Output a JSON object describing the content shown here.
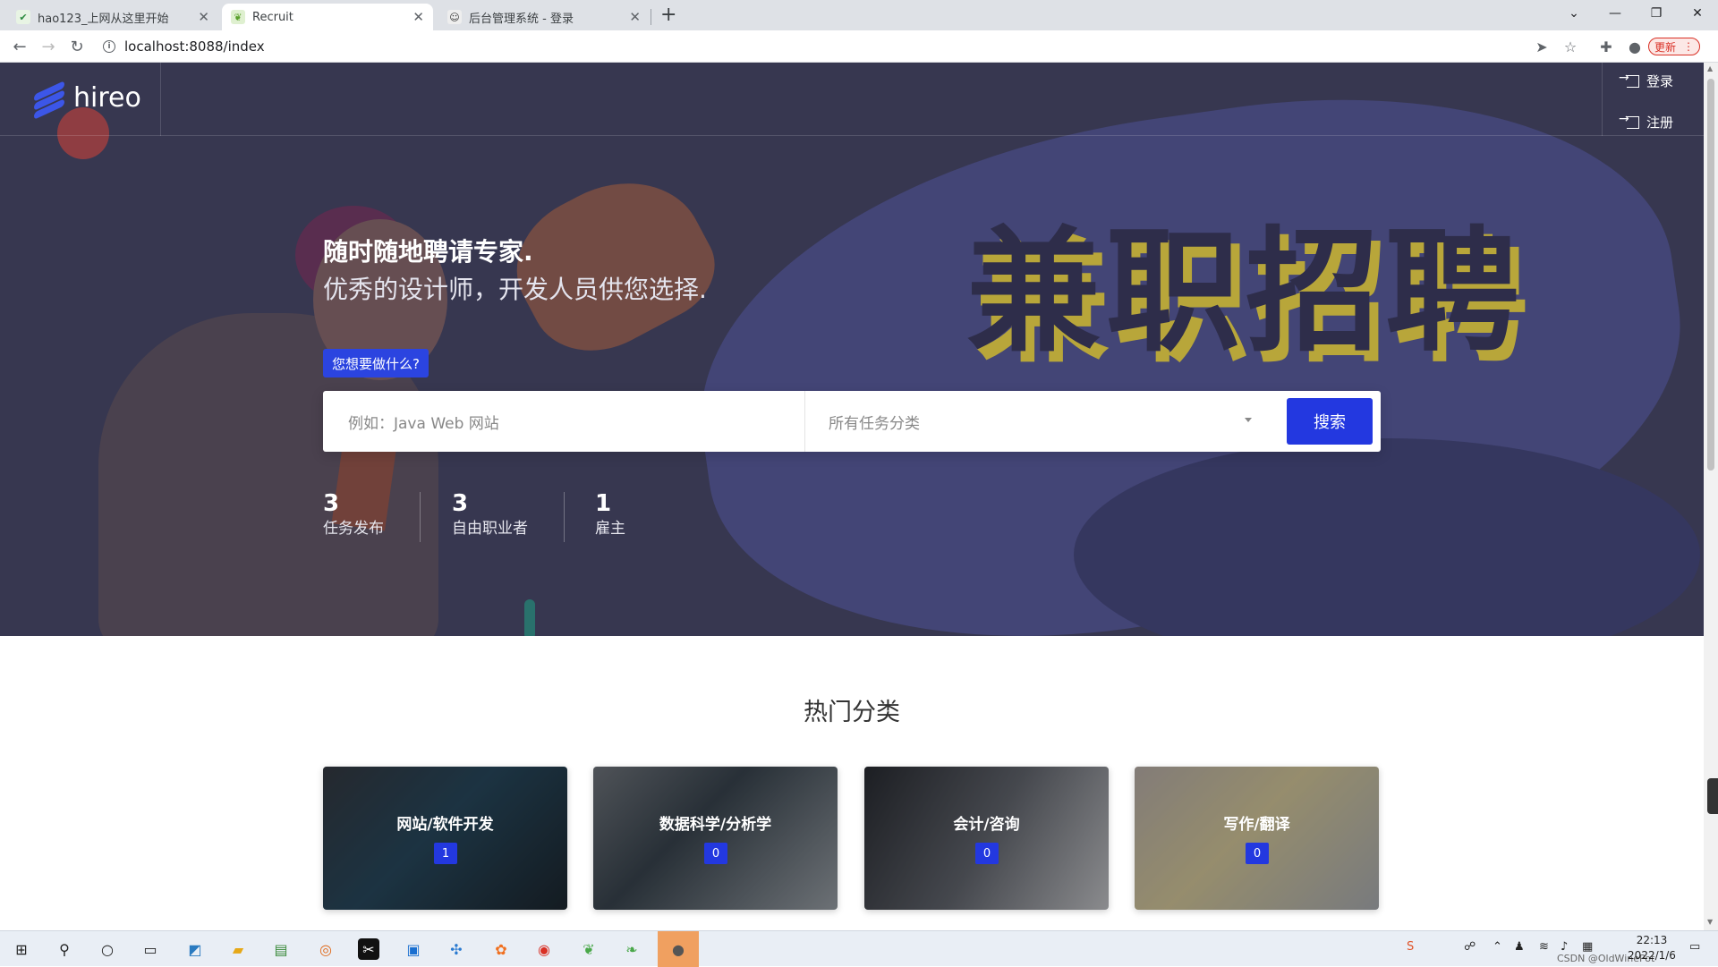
{
  "browser": {
    "tabs": [
      {
        "title": "hao123_上网从这里开始",
        "active": false
      },
      {
        "title": "Recruit",
        "active": true
      },
      {
        "title": "后台管理系统 - 登录",
        "active": false
      }
    ],
    "url": "localhost:8088/index",
    "update_label": "更新"
  },
  "header": {
    "logo_text": "hireo",
    "login_label": "登录",
    "register_label": "注册"
  },
  "hero": {
    "banner_text": "兼职招聘",
    "tagline_primary": "随时随地聘请专家.",
    "tagline_secondary": "优秀的设计师，开发人员供您选择.",
    "ask_badge": "您想要做什么?",
    "search": {
      "keyword_placeholder": "例如：Java Web 网站",
      "category_value": "所有任务分类",
      "button_label": "搜索"
    },
    "stats": [
      {
        "number": "3",
        "label": "任务发布"
      },
      {
        "number": "3",
        "label": "自由职业者"
      },
      {
        "number": "1",
        "label": "雇主"
      }
    ]
  },
  "categories": {
    "title": "热门分类",
    "items": [
      {
        "name": "网站/软件开发",
        "count": "1"
      },
      {
        "name": "数据科学/分析学",
        "count": "0"
      },
      {
        "name": "会计/咨询",
        "count": "0"
      },
      {
        "name": "写作/翻译",
        "count": "0"
      }
    ]
  },
  "taskbar": {
    "time": "22:13",
    "date": "2022/1/6",
    "watermark": "CSDN @OldWinePot"
  },
  "colors": {
    "accent": "#2338e0",
    "hero_bg": "#3d3c57",
    "banner_shadow": "#b8a63a"
  }
}
